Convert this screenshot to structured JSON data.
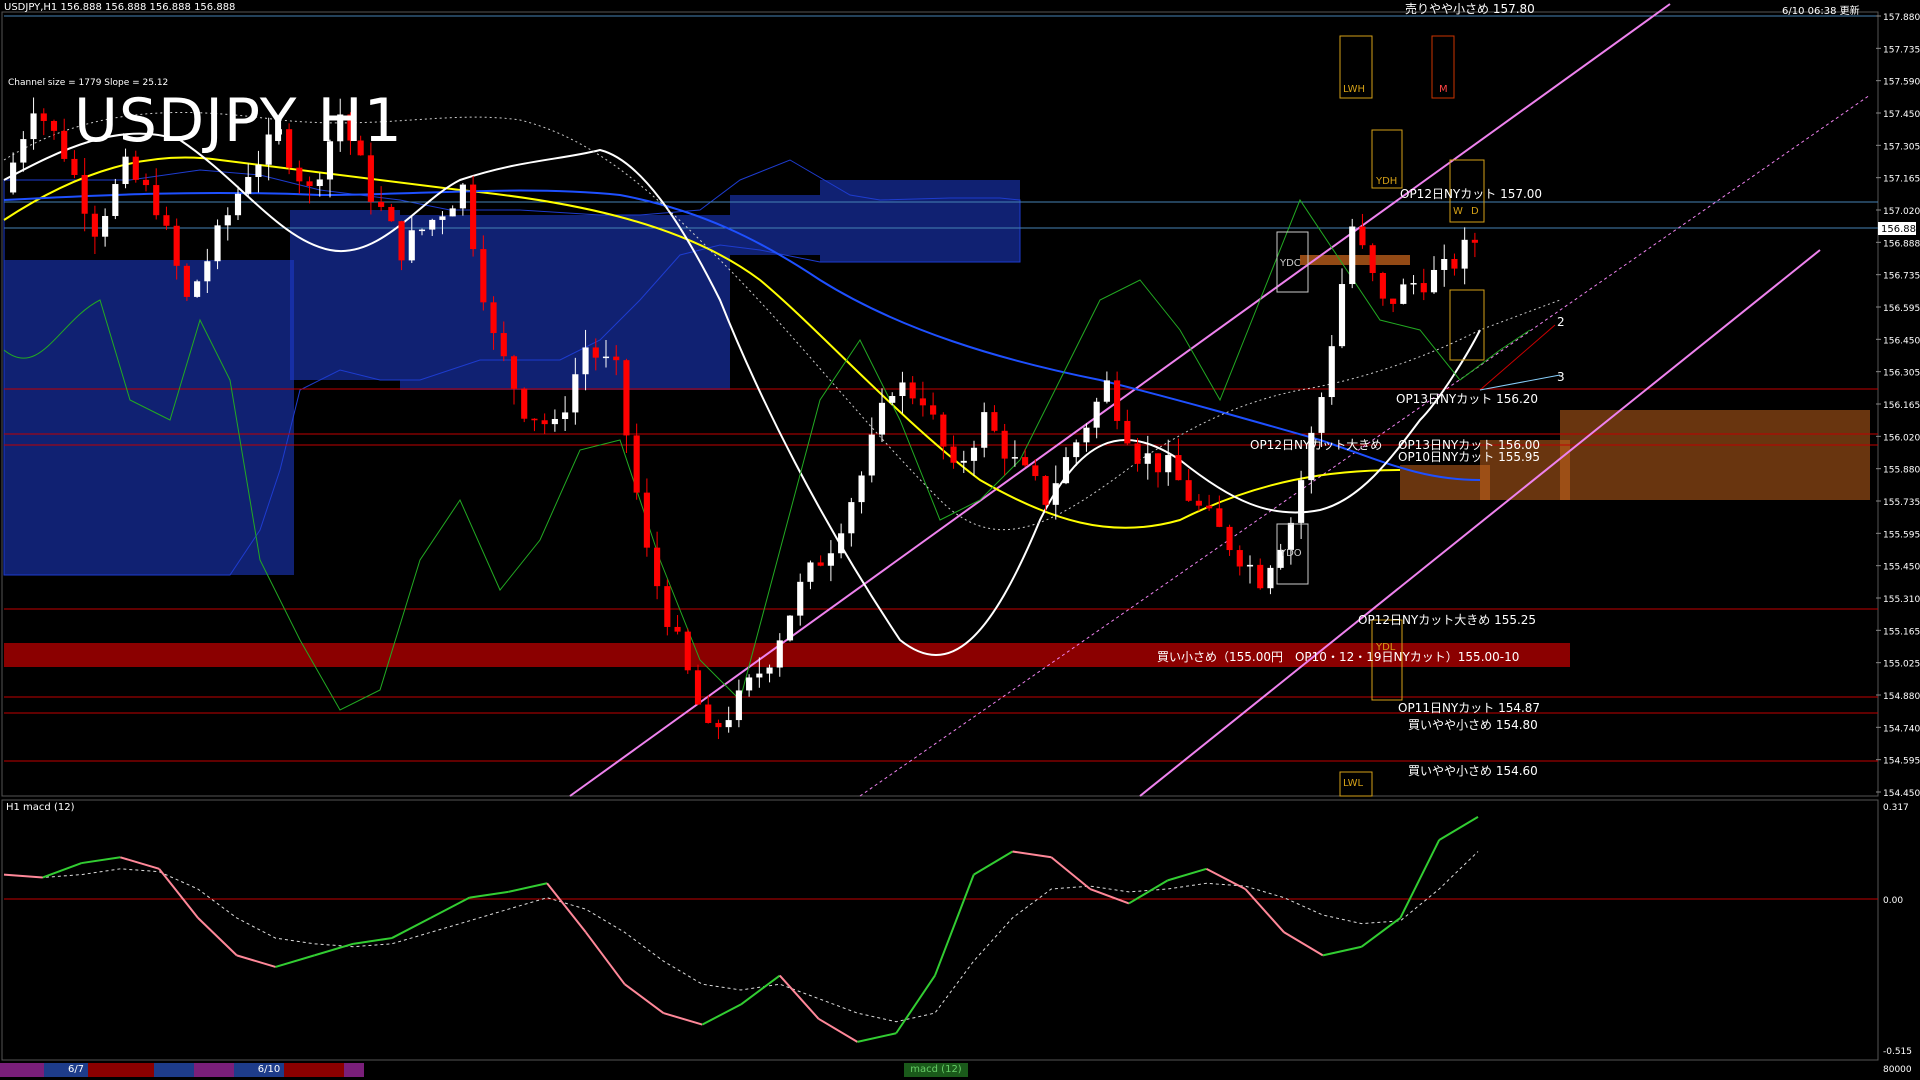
{
  "header": {
    "symbol_info": "USDJPY,H1  156.888 156.888 156.888 156.888",
    "timestamp": "6/10 06:38 更新",
    "big_title": "USDJPY H1",
    "channel_info": "Channel size = 1779 Slope = 25.12"
  },
  "price_axis": {
    "labels": [
      "157.880",
      "157.735",
      "157.590",
      "157.450",
      "157.305",
      "157.165",
      "157.020",
      "156.888",
      "156.735",
      "156.595",
      "156.450",
      "156.305",
      "156.165",
      "156.020",
      "155.880",
      "155.735",
      "155.595",
      "155.450",
      "155.310",
      "155.165",
      "155.025",
      "154.880",
      "154.740",
      "154.595",
      "154.450"
    ],
    "current_price": "156.888"
  },
  "annotations": {
    "sell_top": "売りやや小さめ 157.80",
    "op12_1700": "OP12日NYカット 157.00",
    "op13_1620": "OP13日NYカット 156.20",
    "op12_big_1600": "OP12日NYカット大きめ",
    "op13_1600": "OP13日NYカット 156.00",
    "op10_1595": "OP10日NYカット 155.95",
    "op12_big_1525": "OP12日NYカット大きめ 155.25",
    "buy_band": "買い小さめ（155.00円　OP10・12・19日NYカット）155.00-10",
    "op11_1487": "OP11日NYカット 154.87",
    "buy_1480": "買いやや小さめ 154.80",
    "buy_1460": "買いやや小さめ 154.60",
    "ydc": "YDC",
    "ydo": "YDO",
    "ydh": "YDH",
    "ydl": "YDL",
    "lwh": "LWH",
    "lwl": "LWL",
    "m_label": "M",
    "w_label": "W",
    "d_label": "D",
    "wave_2": "2",
    "wave_3": "3"
  },
  "macd_panel": {
    "title": "H1  macd (12)",
    "axis_labels": [
      "0.317",
      "0.00",
      "-0.515"
    ],
    "bottom_right": "80000"
  },
  "time_tabs": [
    "6/7",
    "6/10"
  ],
  "bottom_status": "macd (12)",
  "colors": {
    "background": "#000000",
    "bull": "#ffffff",
    "bear": "#ff0000",
    "kumo_blue": "#1e3ccf",
    "kumo_orange": "#d2691e",
    "buy_band": "#8b0000",
    "channel": "#ee82ee",
    "sma_yellow": "#ffff00",
    "sma_blue": "#1e50ff",
    "macd_green": "#32cd32",
    "macd_pink": "#ff8899"
  },
  "chart_data": {
    "type": "candlestick",
    "title": "USDJPY H1",
    "timeframe": "H1",
    "ylim": [
      154.45,
      157.88
    ],
    "current_price": 156.888,
    "x": [
      "6/7",
      "6/10"
    ],
    "ohlc_path": [
      157.1,
      157.5,
      157.28,
      156.95,
      157.2,
      157.05,
      156.62,
      156.9,
      157.2,
      157.35,
      157.1,
      157.45,
      157.1,
      156.85,
      156.98,
      157.12,
      156.45,
      156.15,
      156.05,
      156.42,
      156.3,
      155.5,
      155.1,
      154.7,
      154.85,
      155.05,
      155.35,
      155.55,
      155.85,
      156.25,
      156.2,
      155.85,
      156.1,
      155.9,
      155.75,
      156.0,
      156.25,
      155.95,
      155.88,
      155.7,
      155.55,
      155.4,
      155.65,
      156.2,
      156.95,
      156.6,
      156.7,
      156.75,
      156.888
    ],
    "levels": [
      {
        "label": "売りやや小さめ",
        "value": 157.8
      },
      {
        "label": "OP12日NYカット",
        "value": 157.0
      },
      {
        "label": "OP13日NYカット",
        "value": 156.2
      },
      {
        "label": "OP13日NYカット",
        "value": 156.0
      },
      {
        "label": "OP10日NYカット",
        "value": 155.95
      },
      {
        "label": "OP12日NYカット大きめ",
        "value": 155.25
      },
      {
        "label": "買い小さめ（155.00円　OP10・12・19日NYカット）",
        "value": 155.05
      },
      {
        "label": "OP11日NYカット",
        "value": 154.87
      },
      {
        "label": "買いやや小さめ",
        "value": 154.8
      },
      {
        "label": "買いやや小さめ",
        "value": 154.6
      }
    ],
    "macd": {
      "ylim": [
        -0.515,
        0.317
      ],
      "main": [
        0.1,
        0.09,
        0.14,
        0.16,
        0.12,
        -0.05,
        -0.18,
        -0.22,
        -0.18,
        -0.14,
        -0.12,
        -0.05,
        0.02,
        0.04,
        0.07,
        -0.1,
        -0.28,
        -0.38,
        -0.42,
        -0.35,
        -0.25,
        -0.4,
        -0.48,
        -0.45,
        -0.25,
        0.1,
        0.18,
        0.16,
        0.05,
        0.0,
        0.08,
        0.12,
        0.05,
        -0.1,
        -0.18,
        -0.15,
        -0.05,
        0.22,
        0.3
      ],
      "signal": [
        0.1,
        0.09,
        0.1,
        0.12,
        0.11,
        0.05,
        -0.05,
        -0.12,
        -0.14,
        -0.15,
        -0.14,
        -0.1,
        -0.06,
        -0.02,
        0.02,
        -0.02,
        -0.1,
        -0.2,
        -0.28,
        -0.3,
        -0.28,
        -0.33,
        -0.38,
        -0.41,
        -0.38,
        -0.2,
        -0.05,
        0.05,
        0.06,
        0.04,
        0.05,
        0.07,
        0.06,
        0.02,
        -0.04,
        -0.07,
        -0.06,
        0.05,
        0.18
      ]
    }
  }
}
